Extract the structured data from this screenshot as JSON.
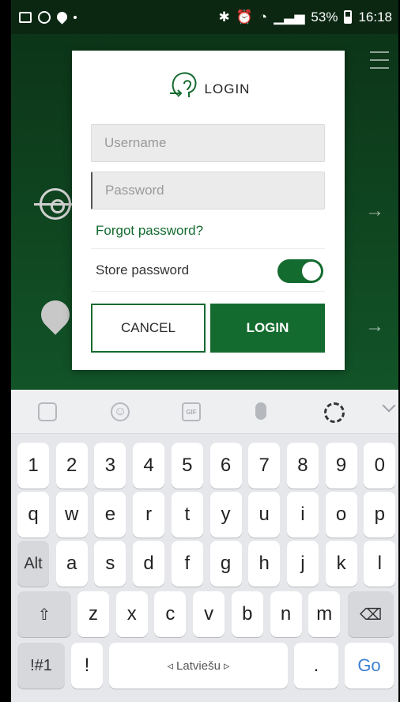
{
  "status_bar": {
    "battery": "53%",
    "time": "16:18",
    "left_icons": [
      "gallery-icon",
      "whatsapp-icon",
      "location-icon",
      "dot-icon"
    ],
    "right_icons": [
      "bluetooth-icon",
      "alarm-icon",
      "wifi-icon",
      "signal-icon",
      "battery-icon"
    ]
  },
  "background_app": {
    "menu_icon": "hamburger-icon",
    "arrow_glyph": "→"
  },
  "dialog": {
    "title": "LOGIN",
    "logo_icon": "person-login-icon",
    "username_placeholder": "Username",
    "password_placeholder": "Password",
    "forgot_label": "Forgot password?",
    "store_label": "Store password",
    "store_enabled": true,
    "cancel_label": "CANCEL",
    "login_label": "LOGIN",
    "accent_color": "#146b2f"
  },
  "keyboard": {
    "toolbar": [
      "sticker-icon",
      "emoji-icon",
      "gif-icon",
      "microphone-icon",
      "settings-icon",
      "collapse-chevron-icon"
    ],
    "gif_text": "GIF",
    "row_numbers": [
      "1",
      "2",
      "3",
      "4",
      "5",
      "6",
      "7",
      "8",
      "9",
      "0"
    ],
    "row_top": [
      "q",
      "w",
      "e",
      "r",
      "t",
      "y",
      "u",
      "i",
      "o",
      "p"
    ],
    "row_home": [
      "a",
      "s",
      "d",
      "f",
      "g",
      "h",
      "j",
      "k",
      "l"
    ],
    "row_bottom": [
      "z",
      "x",
      "c",
      "v",
      "b",
      "n",
      "m"
    ],
    "alt_key": "Alt",
    "symbols_key": "!#1",
    "exclaim_key": "!",
    "space_label": "◃ Latviešu ▹",
    "period_key": ".",
    "go_key": "Go",
    "shift_glyph": "⇧",
    "backspace_glyph": "⌫"
  }
}
